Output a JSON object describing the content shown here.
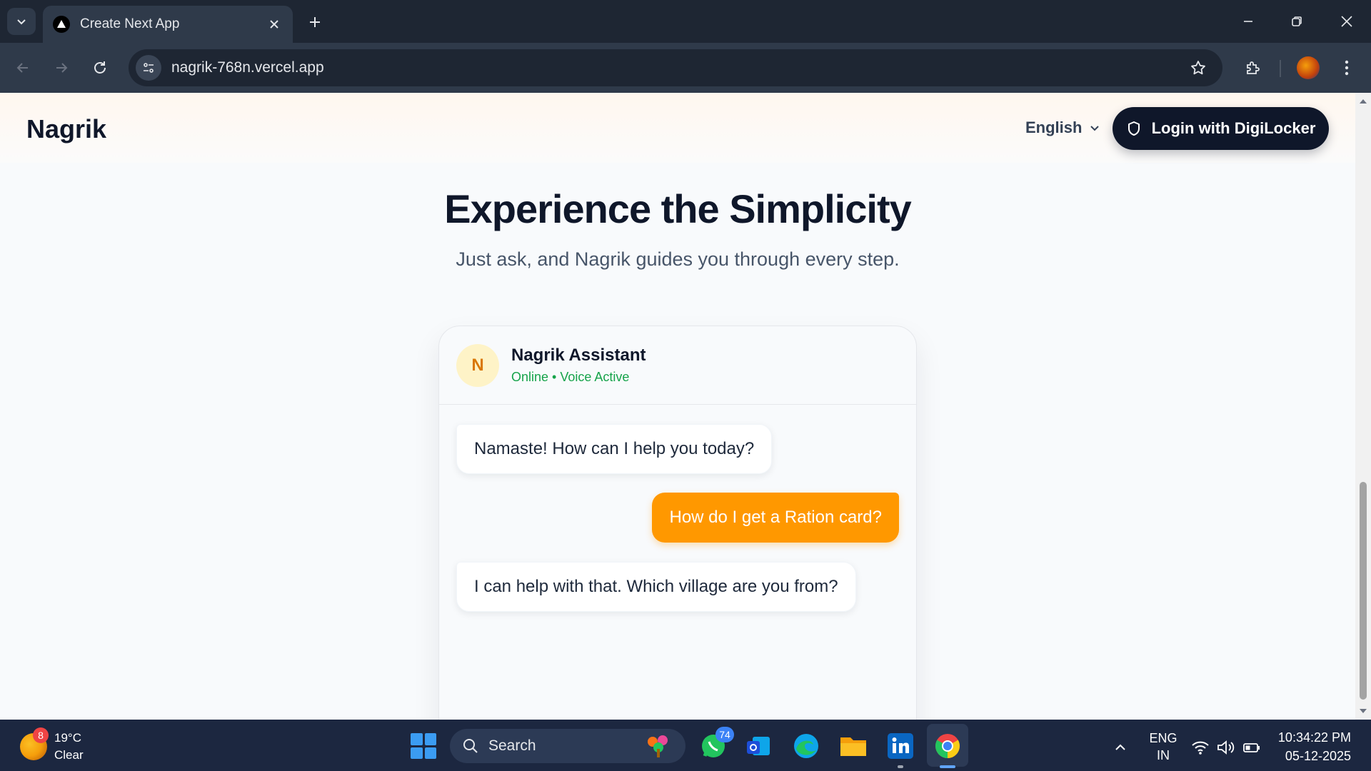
{
  "browser": {
    "tab_title": "Create Next App",
    "url": "nagrik-768n.vercel.app"
  },
  "header": {
    "brand": "Nagrik",
    "language": "English",
    "login_label": "Login with DigiLocker"
  },
  "hero": {
    "title": "Experience the Simplicity",
    "subtitle": "Just ask, and Nagrik guides you through every step."
  },
  "chat": {
    "avatar_letter": "N",
    "name": "Nagrik Assistant",
    "status": "Online • Voice Active",
    "messages": [
      {
        "from": "bot",
        "text": "Namaste! How can I help you today?"
      },
      {
        "from": "user",
        "text": "How do I get a Ration card?"
      },
      {
        "from": "bot",
        "text": "I can help with that. Which village are you from?"
      }
    ]
  },
  "taskbar": {
    "weather_badge": "8",
    "temperature": "19°C",
    "condition": "Clear",
    "search_placeholder": "Search",
    "whatsapp_badge": "74",
    "lang_line1": "ENG",
    "lang_line2": "IN",
    "time": "10:34:22 PM",
    "date": "05-12-2025"
  },
  "colors": {
    "accent": "#ff9800",
    "primary_dark": "#0f172a",
    "online_green": "#16a34a"
  }
}
